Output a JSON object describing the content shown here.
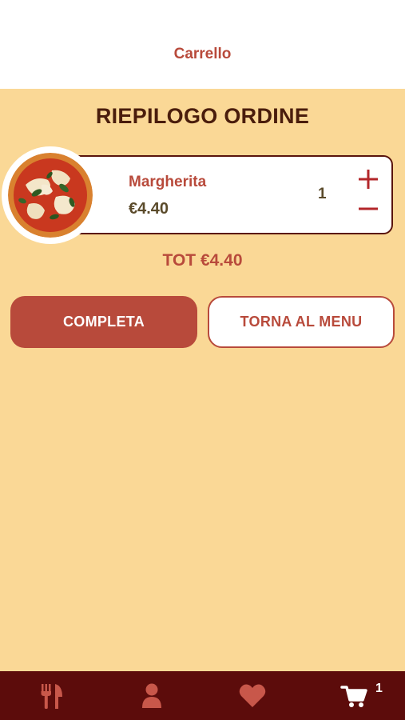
{
  "header": {
    "title": "Carrello"
  },
  "summary": {
    "title": "RIEPILOGO ORDINE"
  },
  "cart": {
    "items": [
      {
        "name": "Margherita",
        "price": "€4.40",
        "quantity": "1"
      }
    ],
    "total": "TOT €4.40"
  },
  "actions": {
    "complete_label": "COMPLETA",
    "back_label": "TORNA AL MENU"
  },
  "tabbar": {
    "tabs": [
      {
        "icon": "fork-knife-icon",
        "active": false
      },
      {
        "icon": "user-icon",
        "active": false
      },
      {
        "icon": "heart-icon",
        "active": false
      },
      {
        "icon": "cart-icon",
        "active": true
      }
    ],
    "cart_badge": "1"
  },
  "colors": {
    "background": "#fad896",
    "accent": "#b84a3b",
    "dark": "#5c0c0b"
  }
}
